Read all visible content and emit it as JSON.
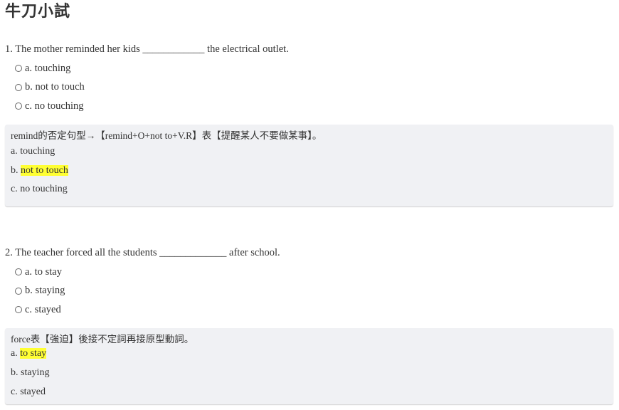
{
  "page": {
    "title": "牛刀小試"
  },
  "questions": [
    {
      "text": "1. The mother reminded her kids ____________ the electrical outlet.",
      "options": [
        "a. touching",
        "b. not to touch",
        "c. no touching"
      ],
      "explanation": {
        "note": "remind的否定句型→【remind+O+not to+V.R】表【提醒某人不要做某事】。",
        "lines": [
          {
            "prefix": "a. ",
            "text": "touching",
            "highlight": false
          },
          {
            "prefix": "b. ",
            "text": "not to touch",
            "highlight": true
          },
          {
            "prefix": "c. ",
            "text": "no touching",
            "highlight": false
          }
        ]
      }
    },
    {
      "text": "2. The teacher forced all the students _____________ after school.",
      "options": [
        "a. to stay",
        "b. staying",
        "c. stayed"
      ],
      "explanation": {
        "note": "force表【強迫】後接不定詞再接原型動詞。",
        "lines": [
          {
            "prefix": "a. ",
            "text": "to stay",
            "highlight": true
          },
          {
            "prefix": "b. ",
            "text": "staying",
            "highlight": false
          },
          {
            "prefix": "c. ",
            "text": "stayed",
            "highlight": false
          }
        ]
      }
    }
  ],
  "colors": {
    "highlight": "#ffff33",
    "explain_bg": "#f0f1f4",
    "text": "#333333"
  }
}
